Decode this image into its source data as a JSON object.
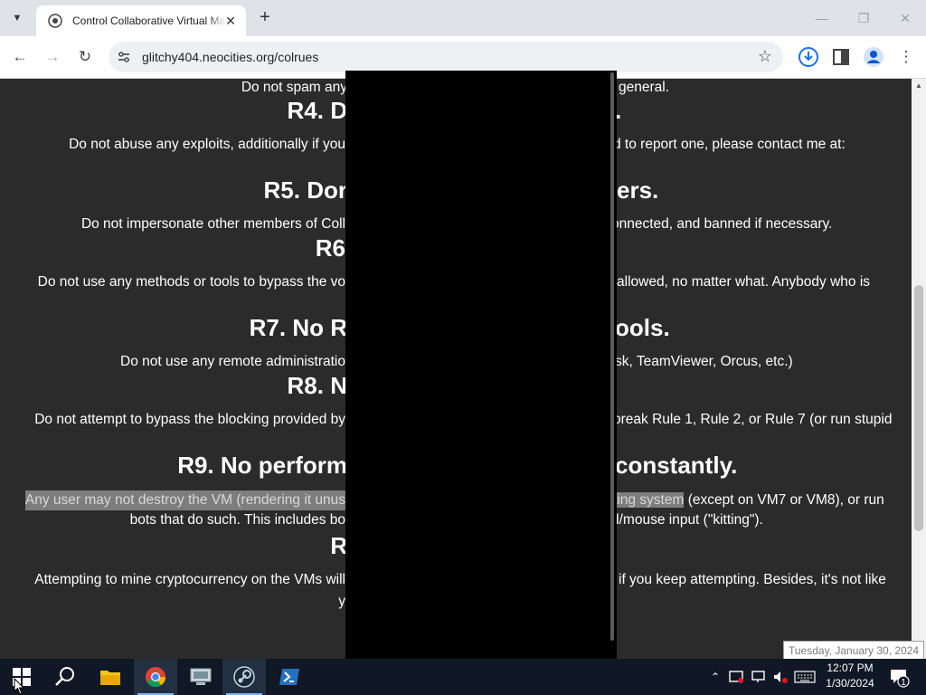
{
  "browser": {
    "tab": {
      "title": "Control Collaborative Virtual Machines"
    },
    "address": {
      "url": "glitchy404.neocities.org/colrues"
    }
  },
  "page": {
    "lines": [
      {
        "kind": "p",
        "left": "Do not spam any",
        "right": "general."
      },
      {
        "kind": "h",
        "left": "R4. D",
        "right": "."
      },
      {
        "kind": "p",
        "left": "Do not abuse any exploits, additionally if you",
        "right": "d to report one, please contact me at:"
      },
      {
        "kind": "h",
        "left": "R5. Dor",
        "right": "ers."
      },
      {
        "kind": "p",
        "left": "Do not impersonate other members of Coll",
        "right": "onnected, and banned if necessary."
      },
      {
        "kind": "h",
        "left": "R6",
        "right": ""
      },
      {
        "kind": "p",
        "left": "Do not use any methods or tools to bypass the vo",
        "right": "allowed, no matter what. Anybody who is"
      },
      {
        "kind": "h",
        "left": "R7. No R",
        "right": "ools."
      },
      {
        "kind": "p",
        "left": "Do not use any remote administratio",
        "right": "sk, TeamViewer, Orcus, etc.)"
      },
      {
        "kind": "h",
        "left": "R8. N",
        "right": ""
      },
      {
        "kind": "p",
        "left": "Do not attempt to bypass the blocking provided by",
        "right": "oreak Rule 1, Rule 2, or Rule 7 (or run stupid"
      },
      {
        "kind": "h",
        "left": "R9. No perform",
        "right": "constantly."
      },
      {
        "kind": "p",
        "left": "Any user may not destroy the VM (rendering it unus",
        "right": "ting system",
        "right_rest": " (except on VM7 or VM8), or run",
        "highlight": true
      },
      {
        "kind": "p",
        "left": "bots that do such. This includes bo",
        "right": "d/mouse input (\"kitting\")."
      },
      {
        "kind": "h",
        "left": "R",
        "right": ""
      },
      {
        "kind": "p",
        "left": "Attempting to mine cryptocurrency on the VMs will",
        "right": "if you keep attempting. Besides, it's not like"
      },
      {
        "kind": "p",
        "left": "y",
        "right": ""
      }
    ]
  },
  "tooltip": {
    "text": "Tuesday, January 30, 2024"
  },
  "taskbar": {
    "items": [
      "start-icon",
      "search-icon",
      "file-explorer-icon",
      "chrome-icon",
      "vm-app-icon",
      "steam-icon",
      "powershell-icon"
    ],
    "clock": {
      "time": "12:07 PM",
      "date": "1/30/2024"
    },
    "notifications": {
      "count": "1"
    }
  },
  "colors": {
    "page_bg": "#2b2b2b",
    "highlight_bg": "#7d7d7d",
    "taskbar": "#101826"
  }
}
